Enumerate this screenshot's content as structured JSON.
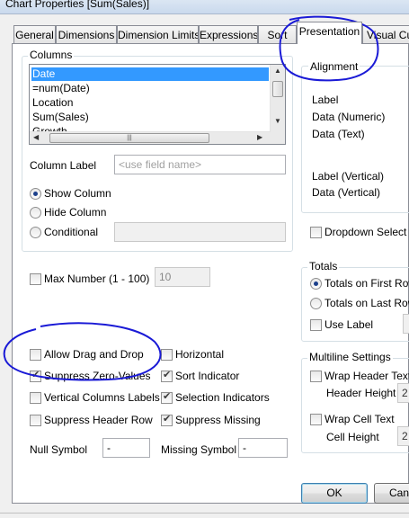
{
  "window": {
    "title": "Chart Properties [Sum(Sales)]"
  },
  "tabs": [
    "General",
    "Dimensions",
    "Dimension Limits",
    "Expressions",
    "Sort",
    "Presentation",
    "Visual Cue"
  ],
  "columns": {
    "group_label": "Columns",
    "items": [
      "Date",
      "=num(Date)",
      "Location",
      "Sum(Sales)",
      "Growth"
    ],
    "selected": "Date",
    "column_label": "Column Label",
    "column_label_placeholder": "<use field name>",
    "show_column": "Show Column",
    "hide_column": "Hide Column",
    "conditional": "Conditional"
  },
  "alignment": {
    "group_label": "Alignment",
    "rows": [
      "Label",
      "Data (Numeric)",
      "Data (Text)",
      "Label (Vertical)",
      "Data (Vertical)"
    ]
  },
  "dropdown_select": "Dropdown Select",
  "max_number": {
    "label": "Max Number (1 - 100)",
    "value": "10"
  },
  "totals": {
    "group_label": "Totals",
    "first_row": "Totals on First Row",
    "last_row": "Totals on Last Row",
    "use_label": "Use Label"
  },
  "options_left": {
    "allow_drag_drop": "Allow Drag and Drop",
    "suppress_zero": "Suppress Zero-Values",
    "vertical_columns": "Vertical Columns Labels",
    "suppress_header": "Suppress Header Row"
  },
  "options_right": {
    "horizontal": "Horizontal",
    "sort_indicator": "Sort Indicator",
    "selection_indicators": "Selection Indicators",
    "suppress_missing": "Suppress Missing"
  },
  "null_symbol": {
    "label": "Null Symbol",
    "value": "-"
  },
  "missing_symbol": {
    "label": "Missing Symbol",
    "value": "-"
  },
  "multiline": {
    "group_label": "Multiline Settings",
    "wrap_header": "Wrap Header Text",
    "header_height": "Header Height",
    "header_height_value": "2",
    "wrap_cell": "Wrap Cell Text",
    "cell_height": "Cell Height",
    "cell_height_value": "2"
  },
  "buttons": {
    "ok": "OK",
    "cancel": "Can"
  },
  "annotation_color": "#1a1ad6"
}
